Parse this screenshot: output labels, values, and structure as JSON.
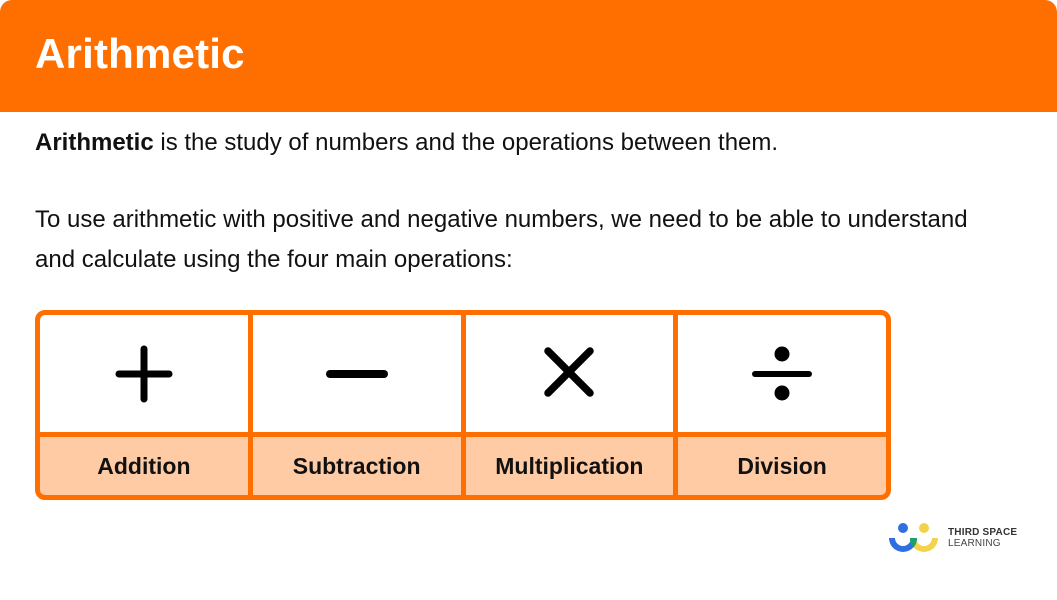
{
  "header": {
    "title": "Arithmetic"
  },
  "intro": {
    "bold_term": "Arithmetic",
    "rest": " is the study of numbers and the operations between them."
  },
  "paragraph2": {
    "text": "To use arithmetic with positive and negative numbers, we need to be able to understand and calculate using the four main operations:"
  },
  "operations": [
    {
      "symbol": "plus-icon",
      "label": "Addition"
    },
    {
      "symbol": "minus-icon",
      "label": "Subtraction"
    },
    {
      "symbol": "multiply-icon",
      "label": "Multiplication"
    },
    {
      "symbol": "divide-icon",
      "label": "Division"
    }
  ],
  "logo": {
    "line1": "THIRD SPACE",
    "line2": "LEARNING"
  },
  "colors": {
    "brand_orange": "#ff6f00",
    "label_fill": "#ffcba4",
    "logo_blue": "#2f6fe0",
    "logo_yellow": "#f2d34b",
    "logo_green": "#1f9e6e"
  }
}
